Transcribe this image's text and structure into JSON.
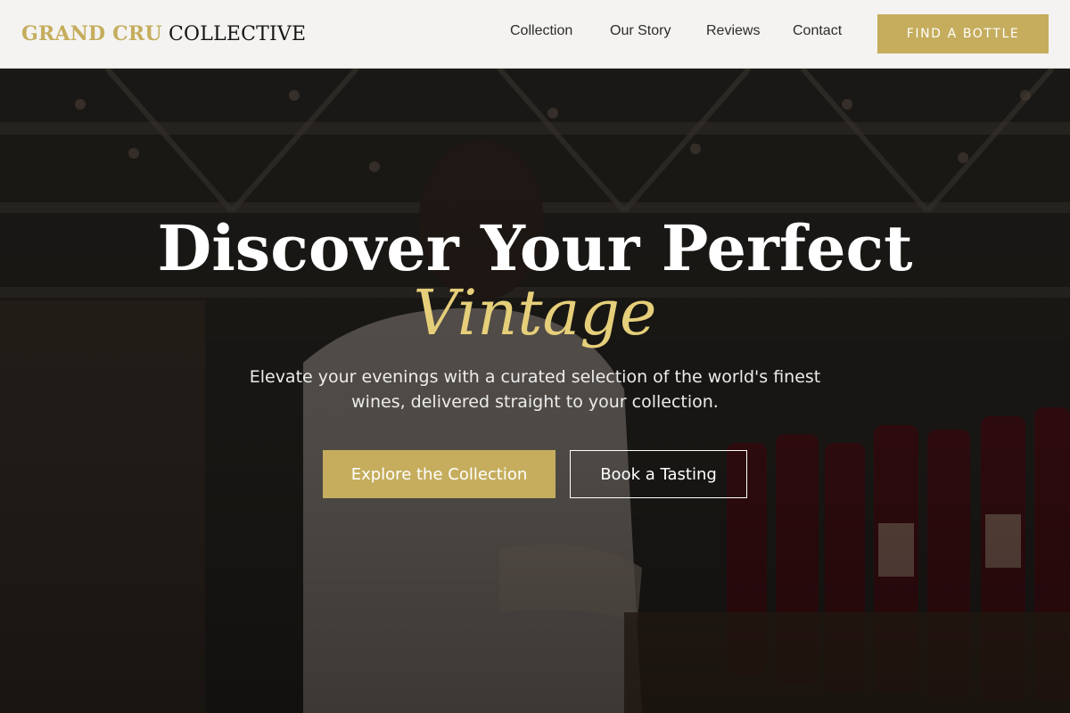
{
  "brand": {
    "name_accent": "GRAND CRU",
    "name_main": "COLLECTIVE",
    "accent_color": "#c5ad5d"
  },
  "nav": {
    "items": [
      {
        "label": "Collection"
      },
      {
        "label": "Our Story"
      },
      {
        "label": "Reviews"
      },
      {
        "label": "Contact"
      }
    ]
  },
  "header_cta": {
    "label": "Find a Bottle"
  },
  "hero": {
    "title": "Discover Your Perfect",
    "title_accent": "Vintage",
    "subtitle": "Elevate your evenings with a curated selection of the world's finest wines, delivered straight to your collection.",
    "primary_button": "Explore the Collection",
    "secondary_button": "Book a Tasting",
    "background_image": "wine-shop-photo"
  }
}
